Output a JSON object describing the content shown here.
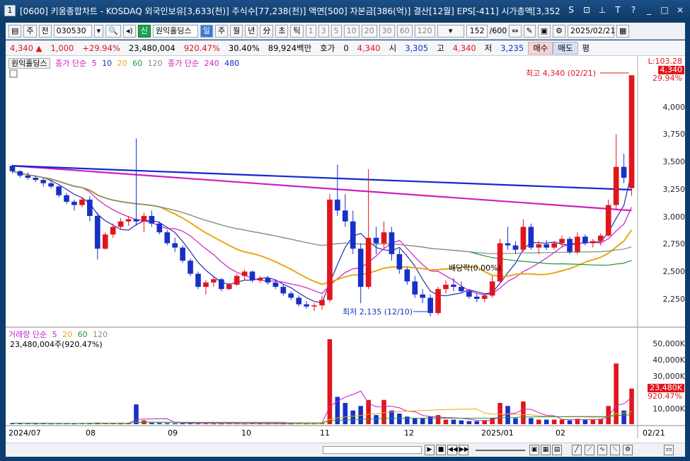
{
  "window": {
    "badge": "1",
    "title": "[0600] 키움종합차트 - KOSDAQ 외국인보유[3,633(천)] 주식수[77,238(천)] 액면[500] 자본금[386(억)] 결산[12월] EPS[-411] 시가총액[3,352",
    "buttons": [
      "S",
      "⊡",
      "⊥",
      "T",
      "?",
      "_",
      "□",
      "×"
    ]
  },
  "toolbar": {
    "period_type": "주",
    "prev_label": "전",
    "code": "030530",
    "name_badge": "신",
    "name": "원익홀딩스",
    "tabs": [
      "일",
      "주",
      "월",
      "년",
      "分",
      "초",
      "틱"
    ],
    "selected_tab": "일",
    "intervals": [
      "1",
      "3",
      "5",
      "10",
      "20",
      "30",
      "60",
      "120"
    ],
    "count": "152",
    "count_total": "/600",
    "date": "2025/02/21"
  },
  "quote": {
    "price": "4,340",
    "change": "1,000",
    "change_pct": "+29.94%",
    "volume": "23,480,004",
    "volume_pct": "920.47%",
    "turnover": "30.40%",
    "amount": "89,924백만",
    "ask_label": "호가",
    "ask_value": "0",
    "bid_value": "4,340",
    "open_label": "시",
    "open_value": "3,305",
    "high_label": "고",
    "high_value": "4,340",
    "low_label": "저",
    "low_value": "3,235",
    "buy_label": "매수",
    "sell_label": "매도",
    "avg_label": "평"
  },
  "price_panel": {
    "stock_label": "원익홀딩스",
    "legend_a": "종가 단순",
    "ma_periods": [
      "5",
      "10",
      "20",
      "60",
      "120"
    ],
    "legend_b": "종가 단순",
    "ma_long": [
      "240",
      "480"
    ],
    "high_annotation": "최고 4,340 (02/21)",
    "low_annotation": "최저 2,135 (12/10)",
    "dividend_annotation": "배당락(0.00%)",
    "last_tag_top": "L:103.28",
    "last_tag_price": "4,340",
    "last_tag_pct": "29.94%",
    "y_ticks": [
      "4,000",
      "3,750",
      "3,500",
      "3,250",
      "3,000",
      "2,750",
      "2,500",
      "2,250"
    ]
  },
  "volume_panel": {
    "label": "거래량 단순",
    "ma_periods": [
      "5",
      "20",
      "60",
      "120"
    ],
    "current": "23,480,004주(920.47%)",
    "tag_value": "23,480K",
    "tag_pct": "920.47%",
    "y_ticks": [
      "50,000K",
      "40,000K",
      "30,000K",
      "20,000K",
      "10,000K"
    ]
  },
  "x_axis": {
    "labels": [
      "2024/07",
      "08",
      "09",
      "10",
      "11",
      "12",
      "2025/01",
      "02"
    ],
    "right_label": "02/21"
  },
  "colors": {
    "up": "#e0161c",
    "down": "#1730c8",
    "ma5": "#2a2ab0",
    "ma10": "#c81ec8",
    "ma20": "#e8a818",
    "ma60": "#1a9a3a",
    "ma120": "#8a8a8a",
    "ma240": "#d020c0",
    "ma480": "#1428d0"
  },
  "chart_data": {
    "type": "candlestick",
    "y_range": [
      2050,
      4400
    ],
    "volume_range": [
      0,
      56000
    ],
    "candles": [
      [
        3510,
        3520,
        3440,
        3460
      ],
      [
        3460,
        3470,
        3400,
        3420
      ],
      [
        3420,
        3450,
        3380,
        3400
      ],
      [
        3400,
        3420,
        3360,
        3380
      ],
      [
        3380,
        3400,
        3320,
        3350
      ],
      [
        3350,
        3380,
        3300,
        3320
      ],
      [
        3320,
        3330,
        3220,
        3240
      ],
      [
        3240,
        3260,
        3160,
        3180
      ],
      [
        3180,
        3200,
        3100,
        3150
      ],
      [
        3150,
        3220,
        3130,
        3200
      ],
      [
        3200,
        3230,
        3000,
        3050
      ],
      [
        3050,
        3080,
        2650,
        2750
      ],
      [
        2750,
        2900,
        2740,
        2880
      ],
      [
        2880,
        2980,
        2850,
        2950
      ],
      [
        2950,
        3030,
        2930,
        3000
      ],
      [
        3000,
        3050,
        2960,
        3020
      ],
      [
        3020,
        3760,
        2960,
        3000
      ],
      [
        3000,
        3080,
        2900,
        3050
      ],
      [
        3050,
        3100,
        2950,
        2980
      ],
      [
        2980,
        3000,
        2880,
        2900
      ],
      [
        2900,
        2920,
        2780,
        2800
      ],
      [
        2800,
        2850,
        2720,
        2760
      ],
      [
        2760,
        2780,
        2620,
        2640
      ],
      [
        2640,
        2660,
        2500,
        2520
      ],
      [
        2520,
        2540,
        2380,
        2400
      ],
      [
        2400,
        2460,
        2330,
        2440
      ],
      [
        2440,
        2490,
        2400,
        2470
      ],
      [
        2470,
        2480,
        2360,
        2380
      ],
      [
        2380,
        2440,
        2370,
        2420
      ],
      [
        2420,
        2520,
        2410,
        2500
      ],
      [
        2500,
        2560,
        2460,
        2540
      ],
      [
        2540,
        2550,
        2440,
        2460
      ],
      [
        2460,
        2500,
        2440,
        2480
      ],
      [
        2480,
        2500,
        2420,
        2440
      ],
      [
        2440,
        2460,
        2380,
        2400
      ],
      [
        2400,
        2420,
        2320,
        2340
      ],
      [
        2340,
        2360,
        2280,
        2300
      ],
      [
        2300,
        2320,
        2220,
        2240
      ],
      [
        2240,
        2270,
        2200,
        2220
      ],
      [
        2220,
        2250,
        2180,
        2230
      ],
      [
        2230,
        2320,
        2190,
        2280
      ],
      [
        2280,
        3250,
        2260,
        3200
      ],
      [
        3200,
        3520,
        3050,
        3100
      ],
      [
        3100,
        3250,
        2950,
        3000
      ],
      [
        3000,
        3100,
        2700,
        2750
      ],
      [
        2750,
        2800,
        2250,
        2400
      ],
      [
        2400,
        3480,
        2380,
        2850
      ],
      [
        2850,
        2950,
        2700,
        2800
      ],
      [
        2800,
        3000,
        2750,
        2900
      ],
      [
        2900,
        2950,
        2640,
        2700
      ],
      [
        2700,
        2750,
        2520,
        2560
      ],
      [
        2560,
        2580,
        2420,
        2450
      ],
      [
        2450,
        2500,
        2300,
        2330
      ],
      [
        2330,
        2380,
        2250,
        2300
      ],
      [
        2300,
        2330,
        2130,
        2160
      ],
      [
        2160,
        2400,
        2140,
        2380
      ],
      [
        2380,
        2460,
        2340,
        2420
      ],
      [
        2420,
        2480,
        2360,
        2400
      ],
      [
        2400,
        2450,
        2340,
        2360
      ],
      [
        2360,
        2380,
        2290,
        2310
      ],
      [
        2310,
        2340,
        2260,
        2290
      ],
      [
        2290,
        2330,
        2260,
        2320
      ],
      [
        2320,
        2500,
        2300,
        2450
      ],
      [
        2450,
        2840,
        2430,
        2800
      ],
      [
        2800,
        2950,
        2740,
        2780
      ],
      [
        2780,
        2820,
        2700,
        2740
      ],
      [
        2740,
        3020,
        2720,
        2950
      ],
      [
        2950,
        2980,
        2740,
        2760
      ],
      [
        2760,
        2820,
        2700,
        2790
      ],
      [
        2790,
        2830,
        2740,
        2760
      ],
      [
        2760,
        2820,
        2740,
        2800
      ],
      [
        2800,
        2870,
        2760,
        2840
      ],
      [
        2840,
        2860,
        2700,
        2720
      ],
      [
        2720,
        2900,
        2700,
        2860
      ],
      [
        2860,
        2880,
        2780,
        2800
      ],
      [
        2800,
        2840,
        2760,
        2820
      ],
      [
        2820,
        2890,
        2780,
        2870
      ],
      [
        2870,
        3200,
        2860,
        3150
      ],
      [
        3150,
        3800,
        3100,
        3500
      ],
      [
        3500,
        3620,
        3350,
        3400
      ],
      [
        3305,
        4340,
        3235,
        4340
      ]
    ],
    "ma_lines": {
      "ma240": [
        [
          0,
          3510
        ],
        [
          80,
          3100
        ]
      ],
      "ma480": [
        [
          0,
          3510
        ],
        [
          80,
          3290
        ]
      ]
    },
    "volumes": [
      700,
      600,
      500,
      400,
      500,
      400,
      600,
      500,
      400,
      500,
      700,
      1000,
      600,
      500,
      400,
      500,
      13000,
      2500,
      900,
      800,
      700,
      600,
      500,
      600,
      700,
      500,
      400,
      400,
      500,
      500,
      400,
      500,
      400,
      400,
      500,
      400,
      400,
      500,
      400,
      400,
      700,
      56000,
      18000,
      14000,
      9000,
      12000,
      16000,
      6000,
      16000,
      9000,
      7000,
      5000,
      4000,
      4000,
      5000,
      6000,
      3000,
      3000,
      2500,
      2000,
      2000,
      2500,
      4000,
      14000,
      12000,
      4000,
      15000,
      4000,
      3000,
      3000,
      3000,
      3000,
      2500,
      3500,
      3000,
      3000,
      3500,
      12000,
      40000,
      9000,
      23480
    ]
  }
}
